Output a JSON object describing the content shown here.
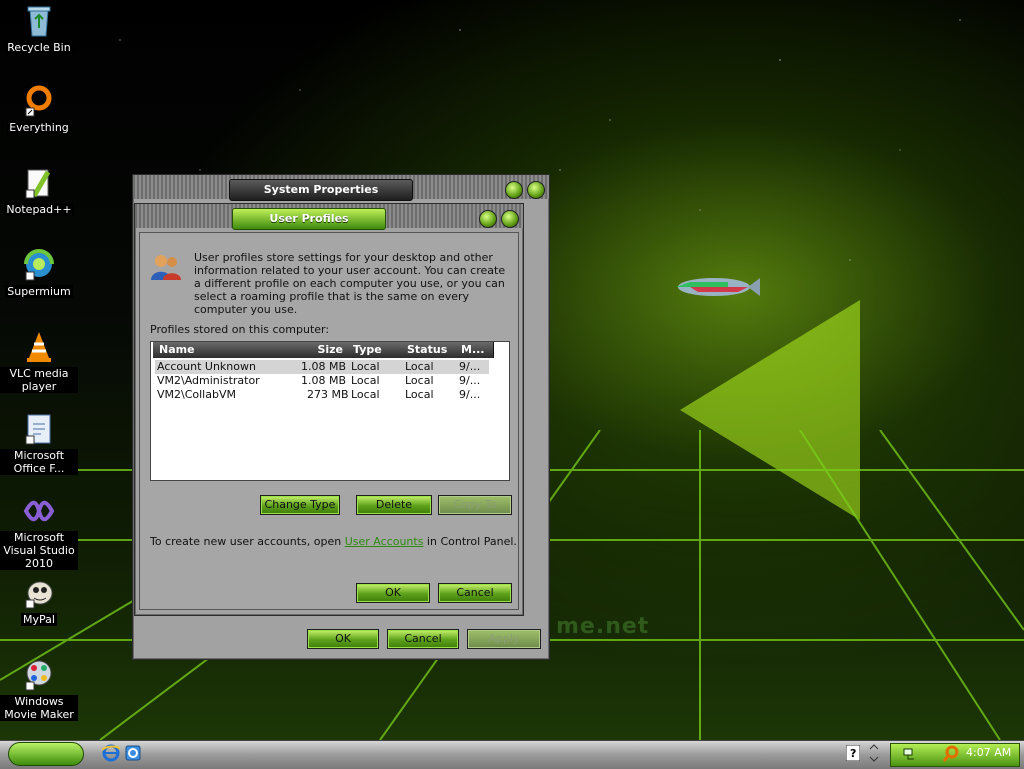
{
  "desktop": {
    "icons": [
      {
        "label": "Recycle Bin",
        "icon": "recycle-bin-icon"
      },
      {
        "label": "Everything",
        "icon": "everything-search-icon"
      },
      {
        "label": "Notepad++",
        "icon": "notepad-plus-plus-icon"
      },
      {
        "label": "Supermium",
        "icon": "supermium-browser-icon"
      },
      {
        "label": "VLC media player",
        "icon": "vlc-cone-icon"
      },
      {
        "label": "Microsoft Office F...",
        "icon": "office-document-icon"
      },
      {
        "label": "Microsoft Visual Studio 2010",
        "icon": "visual-studio-icon"
      },
      {
        "label": "MyPal",
        "icon": "mypal-browser-icon"
      },
      {
        "label": "Windows Movie Maker",
        "icon": "movie-maker-icon"
      }
    ],
    "wallpaper_text": "me.net"
  },
  "system_properties": {
    "title": "System Properties",
    "ok": "OK",
    "cancel": "Cancel",
    "apply": "Apply"
  },
  "user_profiles": {
    "title": "User Profiles",
    "description": "User profiles store settings for your desktop and other information related to your user account. You can create a different profile on each computer you use, or you can select a roaming profile that is the same on every computer you use.",
    "list_label": "Profiles stored on this computer:",
    "columns": [
      "Name",
      "Size",
      "Type",
      "Status",
      "M..."
    ],
    "rows": [
      {
        "name": "Account Unknown",
        "size": "1.08 MB",
        "type": "Local",
        "status": "Local",
        "modified": "9/..."
      },
      {
        "name": "VM2\\Administrator",
        "size": "1.08 MB",
        "type": "Local",
        "status": "Local",
        "modified": "9/..."
      },
      {
        "name": "VM2\\CollabVM",
        "size": "273 MB",
        "type": "Local",
        "status": "Local",
        "modified": "9/..."
      }
    ],
    "change_type": "Change Type",
    "delete": "Delete",
    "copy_to": "Copy To",
    "footer_prefix": "To create new user accounts, open ",
    "footer_link": "User Accounts",
    "footer_suffix": " in Control Panel.",
    "ok": "OK",
    "cancel": "Cancel"
  },
  "taskbar": {
    "clock": "4:07 AM",
    "quick_launch": [
      "internet-explorer-icon",
      "show-desktop-icon"
    ],
    "tray": [
      "help-icon",
      "expand-tray-icon",
      "network-icon",
      "search-icon"
    ]
  },
  "colors": {
    "accent": "#5ca11a",
    "accent_light": "#c7f26c",
    "chrome_gray": "#a2a2a2"
  }
}
